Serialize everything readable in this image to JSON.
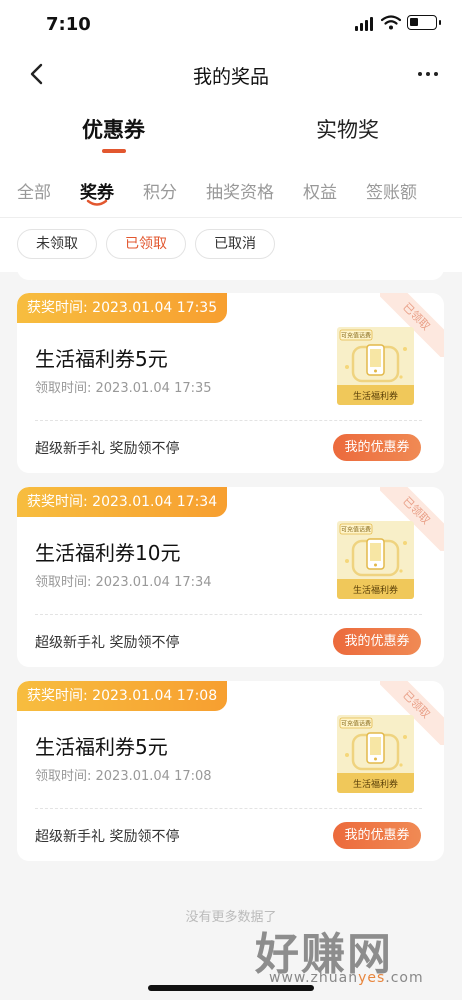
{
  "status_bar": {
    "time": "7:10"
  },
  "nav": {
    "title": "我的奖品"
  },
  "main_tabs": [
    {
      "label": "优惠券"
    },
    {
      "label": "实物奖"
    }
  ],
  "sub_tabs": [
    {
      "label": "全部"
    },
    {
      "label": "奖券"
    },
    {
      "label": "积分"
    },
    {
      "label": "抽奖资格"
    },
    {
      "label": "权益"
    },
    {
      "label": "签账额"
    }
  ],
  "filters": [
    {
      "label": "未领取"
    },
    {
      "label": "已领取"
    },
    {
      "label": "已取消"
    }
  ],
  "cards": [
    {
      "tag": "获奖时间: 2023.01.04 17:35",
      "name": "生活福利券5元",
      "claim_time": "领取时间: 2023.01.04 17:35",
      "stamp": "已领取",
      "thumb_top": "可充值话费",
      "thumb_bottom": "生活福利券",
      "slogan": "超级新手礼 奖励领不停",
      "button": "我的优惠券"
    },
    {
      "tag": "获奖时间: 2023.01.04 17:34",
      "name": "生活福利券10元",
      "claim_time": "领取时间: 2023.01.04 17:34",
      "stamp": "已领取",
      "thumb_top": "可充值话费",
      "thumb_bottom": "生活福利券",
      "slogan": "超级新手礼 奖励领不停",
      "button": "我的优惠券"
    },
    {
      "tag": "获奖时间: 2023.01.04 17:08",
      "name": "生活福利券5元",
      "claim_time": "领取时间: 2023.01.04 17:08",
      "stamp": "已领取",
      "thumb_top": "可充值话费",
      "thumb_bottom": "生活福利券",
      "slogan": "超级新手礼 奖励领不停",
      "button": "我的优惠券"
    }
  ],
  "footer": {
    "no_more": "没有更多数据了"
  },
  "watermark": {
    "text": "好赚网",
    "url_a": "www.zhuan",
    "url_b": "yes",
    "url_c": ".com"
  },
  "colors": {
    "accent": "#e2572f",
    "tag_gold": "#f7bd3f",
    "button": "#ec6a3c"
  }
}
